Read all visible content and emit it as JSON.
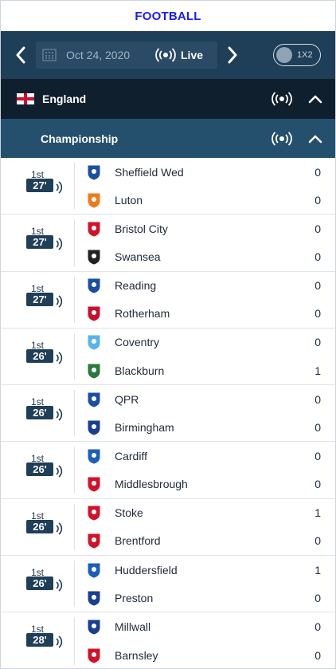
{
  "header": {
    "title": "FOOTBALL"
  },
  "date_bar": {
    "date": "Oct 24, 2020",
    "live_label": "Live",
    "odds_toggle_label": "1X2"
  },
  "country": {
    "name": "England"
  },
  "league": {
    "name": "Championship"
  },
  "matches": [
    {
      "period": "1st",
      "minute": "27'",
      "home": {
        "name": "Sheffield Wed",
        "score": "0",
        "crest_color": "#1b4fa1"
      },
      "away": {
        "name": "Luton",
        "score": "0",
        "crest_color": "#f07a1a"
      }
    },
    {
      "period": "1st",
      "minute": "27'",
      "home": {
        "name": "Bristol City",
        "score": "0",
        "crest_color": "#d3122a"
      },
      "away": {
        "name": "Swansea",
        "score": "0",
        "crest_color": "#222222"
      }
    },
    {
      "period": "1st",
      "minute": "27'",
      "home": {
        "name": "Reading",
        "score": "0",
        "crest_color": "#1b4fa1"
      },
      "away": {
        "name": "Rotherham",
        "score": "0",
        "crest_color": "#c8102e"
      }
    },
    {
      "period": "1st",
      "minute": "26'",
      "home": {
        "name": "Coventry",
        "score": "0",
        "crest_color": "#5ab4e5"
      },
      "away": {
        "name": "Blackburn",
        "score": "1",
        "crest_color": "#2a7a3b"
      }
    },
    {
      "period": "1st",
      "minute": "26'",
      "home": {
        "name": "QPR",
        "score": "0",
        "crest_color": "#1b4fa1"
      },
      "away": {
        "name": "Birmingham",
        "score": "0",
        "crest_color": "#1b3f8f"
      }
    },
    {
      "period": "1st",
      "minute": "26'",
      "home": {
        "name": "Cardiff",
        "score": "0",
        "crest_color": "#1b5fb8"
      },
      "away": {
        "name": "Middlesbrough",
        "score": "0",
        "crest_color": "#d3122a"
      }
    },
    {
      "period": "1st",
      "minute": "26'",
      "home": {
        "name": "Stoke",
        "score": "1",
        "crest_color": "#d3122a"
      },
      "away": {
        "name": "Brentford",
        "score": "0",
        "crest_color": "#d3122a"
      }
    },
    {
      "period": "1st",
      "minute": "26'",
      "home": {
        "name": "Huddersfield",
        "score": "1",
        "crest_color": "#1b5fb8"
      },
      "away": {
        "name": "Preston",
        "score": "0",
        "crest_color": "#1b3f8f"
      }
    },
    {
      "period": "1st",
      "minute": "28'",
      "home": {
        "name": "Millwall",
        "score": "0",
        "crest_color": "#1b3f8f"
      },
      "away": {
        "name": "Barnsley",
        "score": "0",
        "crest_color": "#d3122a"
      }
    }
  ],
  "colors": {
    "title": "#1a1aff",
    "nav_bg": "#1f3e58",
    "country_bg": "#0f1f2d",
    "league_bg": "#24506e"
  },
  "icons": {
    "prev": "chevron-left-icon",
    "next": "chevron-right-icon",
    "calendar": "calendar-icon",
    "live": "live-broadcast-icon",
    "collapse": "chevron-up-icon",
    "match_live": "live-sound-icon",
    "crest": "team-crest-icon"
  }
}
